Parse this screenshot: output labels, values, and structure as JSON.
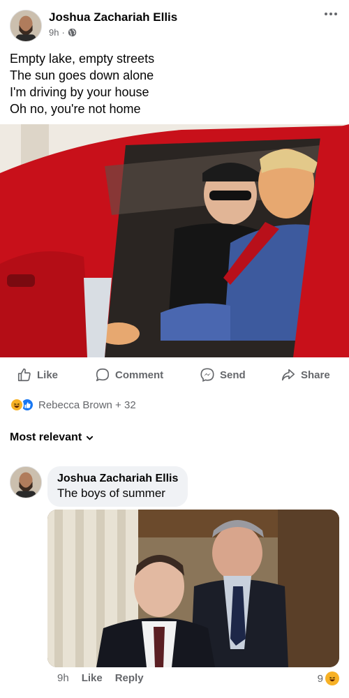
{
  "post": {
    "author": "Joshua Zachariah Ellis",
    "time": "9h",
    "separator": "·",
    "privacy_icon": "globe-icon",
    "lines": [
      "Empty lake, empty streets",
      "The sun goes down alone",
      "I'm driving by your house",
      "Oh no, you're not home"
    ]
  },
  "actions": {
    "like": "Like",
    "comment": "Comment",
    "send": "Send",
    "share": "Share"
  },
  "reactions": {
    "summary": "Rebecca Brown + 32",
    "icons": [
      "haha-icon",
      "like-icon"
    ]
  },
  "sort": {
    "label": "Most relevant"
  },
  "comment": {
    "author": "Joshua Zachariah Ellis",
    "text": "The boys of summer",
    "time": "9h",
    "like": "Like",
    "reply": "Reply",
    "reaction_count": "9",
    "reaction_icon": "haha-icon"
  },
  "colors": {
    "secondary_text": "#65676b",
    "bubble_bg": "#f0f2f5",
    "like_blue": "#1877f2",
    "haha_yellow": "#f7b125",
    "car_red": "#d0141c"
  }
}
